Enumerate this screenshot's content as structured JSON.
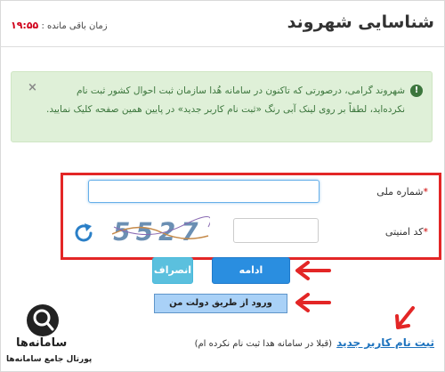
{
  "header": {
    "title": "شناسایی شهروند",
    "timer_label": "زمان باقی مانده :",
    "timer_value": "۱۹:۵۵"
  },
  "alert": {
    "message": "شهروند گرامی، درصورتی که تاکنون در سامانه هُدا سازمان ثبت احوال کشور ثبت نام نکرده‌اید، لطفاً بر روی لینک آبی رنگ «ثبت نام کاربر جدید» در پایین همین صفحه کلیک نمایید.",
    "close_glyph": "×",
    "info_glyph": "!"
  },
  "form": {
    "national_id_label": "شماره ملی",
    "captcha_label": "کد امنیتی",
    "required_mark": "*",
    "national_id_value": "",
    "captcha_value": "",
    "captcha_text": "5527"
  },
  "buttons": {
    "submit": "ادامه",
    "cancel": "انصراف",
    "dolat_login": "ورود از طریق دولت من"
  },
  "register": {
    "link": "ثبت نام کاربر جدید",
    "note": "(قبلا در سامانه هدا ثبت نام نکرده ام)"
  },
  "watermark": {
    "name": "سامانه‌ها",
    "tagline": "پورتال جامع سامانه‌ها"
  },
  "colors": {
    "alert_bg": "#dff0d8",
    "alert_text": "#3c763d",
    "highlight_red": "#e32626",
    "primary_blue": "#2a8ee0",
    "info_blue": "#5bc0de",
    "link_blue": "#1e73be",
    "timer_red": "#d0021b"
  },
  "icons": {
    "refresh": "refresh-icon",
    "close": "close-icon",
    "info": "info-icon",
    "arrow": "red-arrow-icon"
  }
}
